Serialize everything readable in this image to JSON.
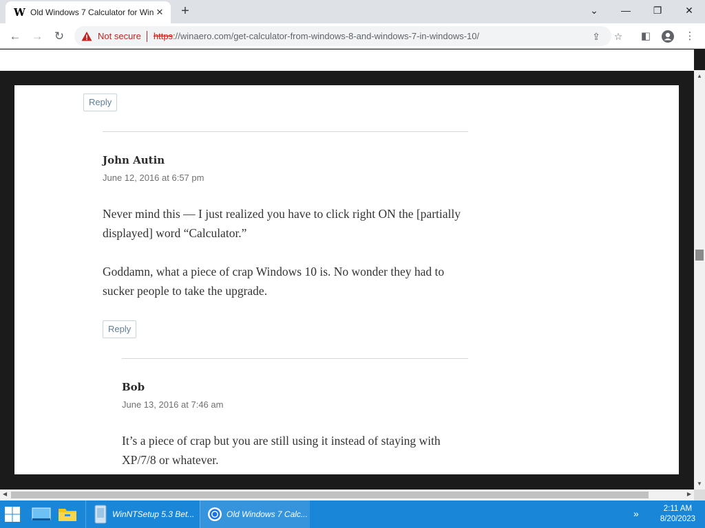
{
  "browser": {
    "tab_title": "Old Windows 7 Calculator for Win",
    "tab_favicon": "W",
    "new_tab_label": "+",
    "security_label": "Not secure",
    "url_scheme": "https",
    "url_rest": "://winaero.com/get-calculator-from-windows-8-and-windows-7-in-windows-10/"
  },
  "page": {
    "comments": [
      {
        "reply_label": "Reply"
      },
      {
        "author": "John Autin",
        "date": "June 12, 2016 at 6:57 pm",
        "paragraphs": [
          "Never mind this — I just realized you have to click right ON the [partially displayed] word “Calculator.”",
          "Goddamn, what a piece of crap Windows 10 is. No wonder they had to sucker people to take the upgrade."
        ],
        "reply_label": "Reply"
      },
      {
        "author": "Bob",
        "date": "June 13, 2016 at 7:46 am",
        "paragraphs": [
          "It’s a piece of crap but you are still using it instead of staying with XP/7/8 or whatever."
        ]
      }
    ]
  },
  "taskbar": {
    "apps": [
      {
        "label": "WinNTSetup 5.3 Bet...",
        "icon": "winntsetup-icon"
      },
      {
        "label": "Old Windows 7 Calc...",
        "icon": "chrome-icon"
      }
    ],
    "time": "2:11 AM",
    "date": "8/20/2023"
  },
  "colors": {
    "taskbar": "#1a86d8",
    "not_secure": "#c5221f",
    "reply_text": "#5e7f95"
  }
}
